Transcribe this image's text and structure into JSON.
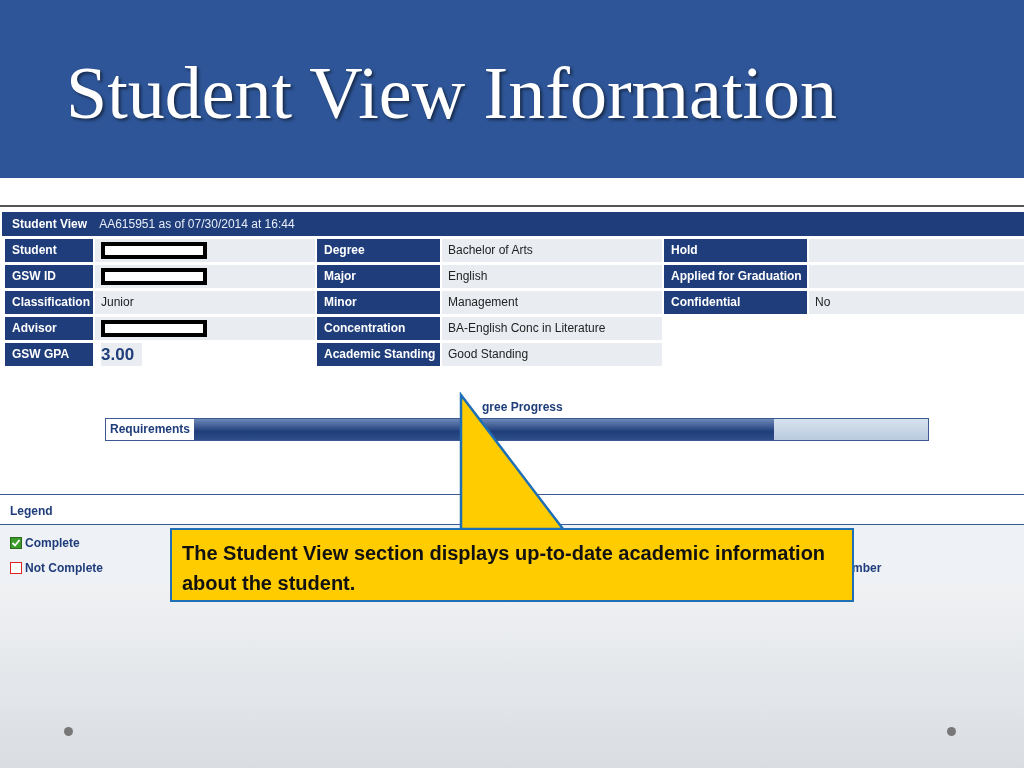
{
  "slide": {
    "title": "Student View Information"
  },
  "student_view": {
    "heading": "Student View",
    "timestamp": "AA615951 as of 07/30/2014 at 16:44",
    "columns": [
      [
        {
          "label": "Student",
          "kind": "redacted"
        },
        {
          "label": "GSW ID",
          "kind": "redacted"
        },
        {
          "label": "Classification",
          "kind": "text",
          "value": "Junior"
        },
        {
          "label": "Advisor",
          "kind": "redacted"
        },
        {
          "label": "GSW GPA",
          "kind": "gpa",
          "value": "3.00"
        }
      ],
      [
        {
          "label": "Degree",
          "kind": "text",
          "value": "Bachelor of Arts"
        },
        {
          "label": "Major",
          "kind": "text",
          "value": "English"
        },
        {
          "label": "Minor",
          "kind": "text",
          "value": "Management"
        },
        {
          "label": "Concentration",
          "kind": "text",
          "value": "BA-English Conc in Literature"
        },
        {
          "label": "Academic Standing",
          "kind": "text",
          "value": "Good Standing"
        }
      ],
      [
        {
          "label": "Hold",
          "kind": "blank"
        },
        {
          "label": "Applied for Graduation",
          "kind": "blank"
        },
        {
          "label": "Confidential",
          "kind": "text",
          "value": "No"
        }
      ]
    ]
  },
  "progress": {
    "title": "gree Progress",
    "bar_label": "Requirements",
    "level": 0.79
  },
  "legend": {
    "title": "Legend",
    "items": [
      {
        "label": "Complete",
        "checked": true
      },
      {
        "label": "Not Complete",
        "checked": false
      }
    ],
    "cut_text": "mber"
  },
  "callout": {
    "text": "The Student View section displays up-to-date academic information about the student."
  }
}
